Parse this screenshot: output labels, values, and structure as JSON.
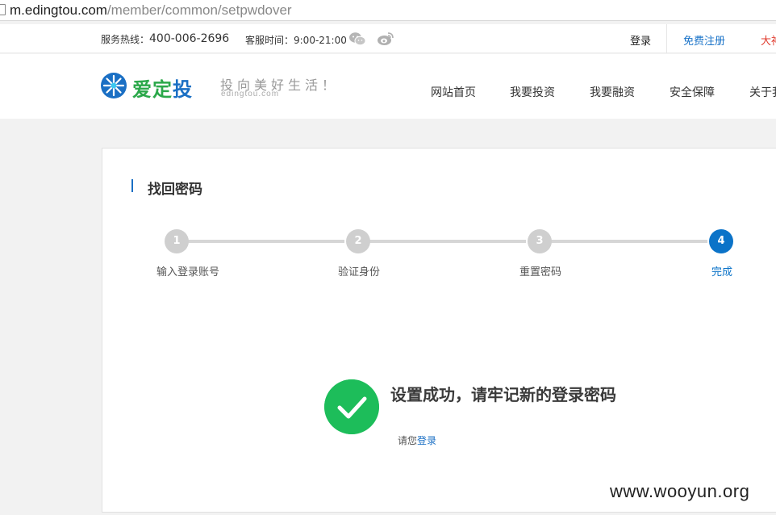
{
  "browser": {
    "url_host": "m.edingtou.com",
    "url_path": "/member/common/setpwdover"
  },
  "topbar": {
    "hotline_label": "服务热线：",
    "hotline_number": "400-006-2696",
    "hours": "客服时间：9:00-21:00",
    "wechat_icon": "wechat-icon",
    "weibo_icon": "weibo-icon",
    "login": "登录",
    "register": "免费注册",
    "more": "大神"
  },
  "header": {
    "logo_part1": "爱定",
    "logo_part2": "投",
    "slogan": "投向美好生活！",
    "slogan_sub": "edingtou.com",
    "nav": [
      "网站首页",
      "我要投资",
      "我要融资",
      "安全保障",
      "关于我们"
    ]
  },
  "page": {
    "title": "找回密码",
    "steps": [
      {
        "num": "1",
        "label": "输入登录账号"
      },
      {
        "num": "2",
        "label": "验证身份"
      },
      {
        "num": "3",
        "label": "重置密码"
      },
      {
        "num": "4",
        "label": "完成"
      }
    ],
    "active_step": 4,
    "success_message": "设置成功，请牢记新的登录密码",
    "hint_prefix": "请您",
    "hint_link": "登录"
  },
  "colors": {
    "accent": "#0b73c8",
    "success": "#1dbd5a",
    "logo_green": "#2ba84a",
    "register_link": "#1a73c8",
    "highlight_red": "#e03b2e"
  },
  "watermark": "www.wooyun.org"
}
